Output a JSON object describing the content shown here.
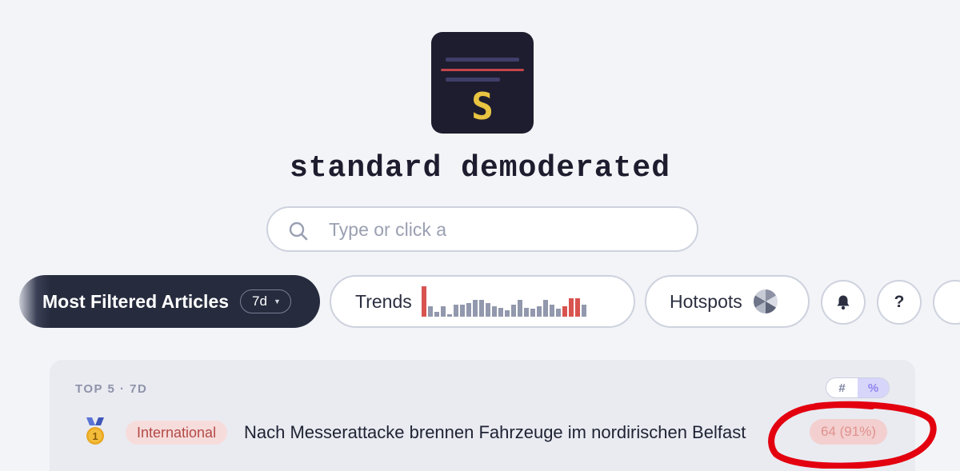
{
  "logo": {
    "letter": "S"
  },
  "site_title": "standard demoderated",
  "search": {
    "placeholder": "Type or click a",
    "value": ""
  },
  "nav": {
    "most_filtered": {
      "label": "Most Filtered Articles",
      "period": "7d"
    },
    "trends": {
      "label": "Trends",
      "sparkline": [
        1.0,
        0.35,
        0.15,
        0.35,
        0.05,
        0.4,
        0.4,
        0.45,
        0.55,
        0.55,
        0.45,
        0.35,
        0.3,
        0.2,
        0.4,
        0.55,
        0.3,
        0.25,
        0.35,
        0.55,
        0.4,
        0.25,
        0.35,
        0.6,
        0.6,
        0.4
      ],
      "highlighted": [
        0,
        22,
        23,
        24
      ],
      "accent_color": "#d9534f",
      "bar_color": "#9298ad"
    },
    "hotspots": {
      "label": "Hotspots",
      "icon": "pie-chart-icon"
    },
    "bell": {
      "icon": "bell-icon"
    },
    "help": {
      "label": "?"
    }
  },
  "card": {
    "caption": "TOP 5 · 7D",
    "toggle": {
      "count_label": "#",
      "percent_label": "%",
      "active": "%"
    },
    "articles": [
      {
        "rank": "1",
        "medal": "gold-medal-icon",
        "category": "International",
        "title": "Nach Messerattacke brennen Fahrzeuge im nordirischen Belfast",
        "count": "64 (91%)"
      }
    ]
  },
  "annotation": {
    "color": "#e3000f"
  }
}
